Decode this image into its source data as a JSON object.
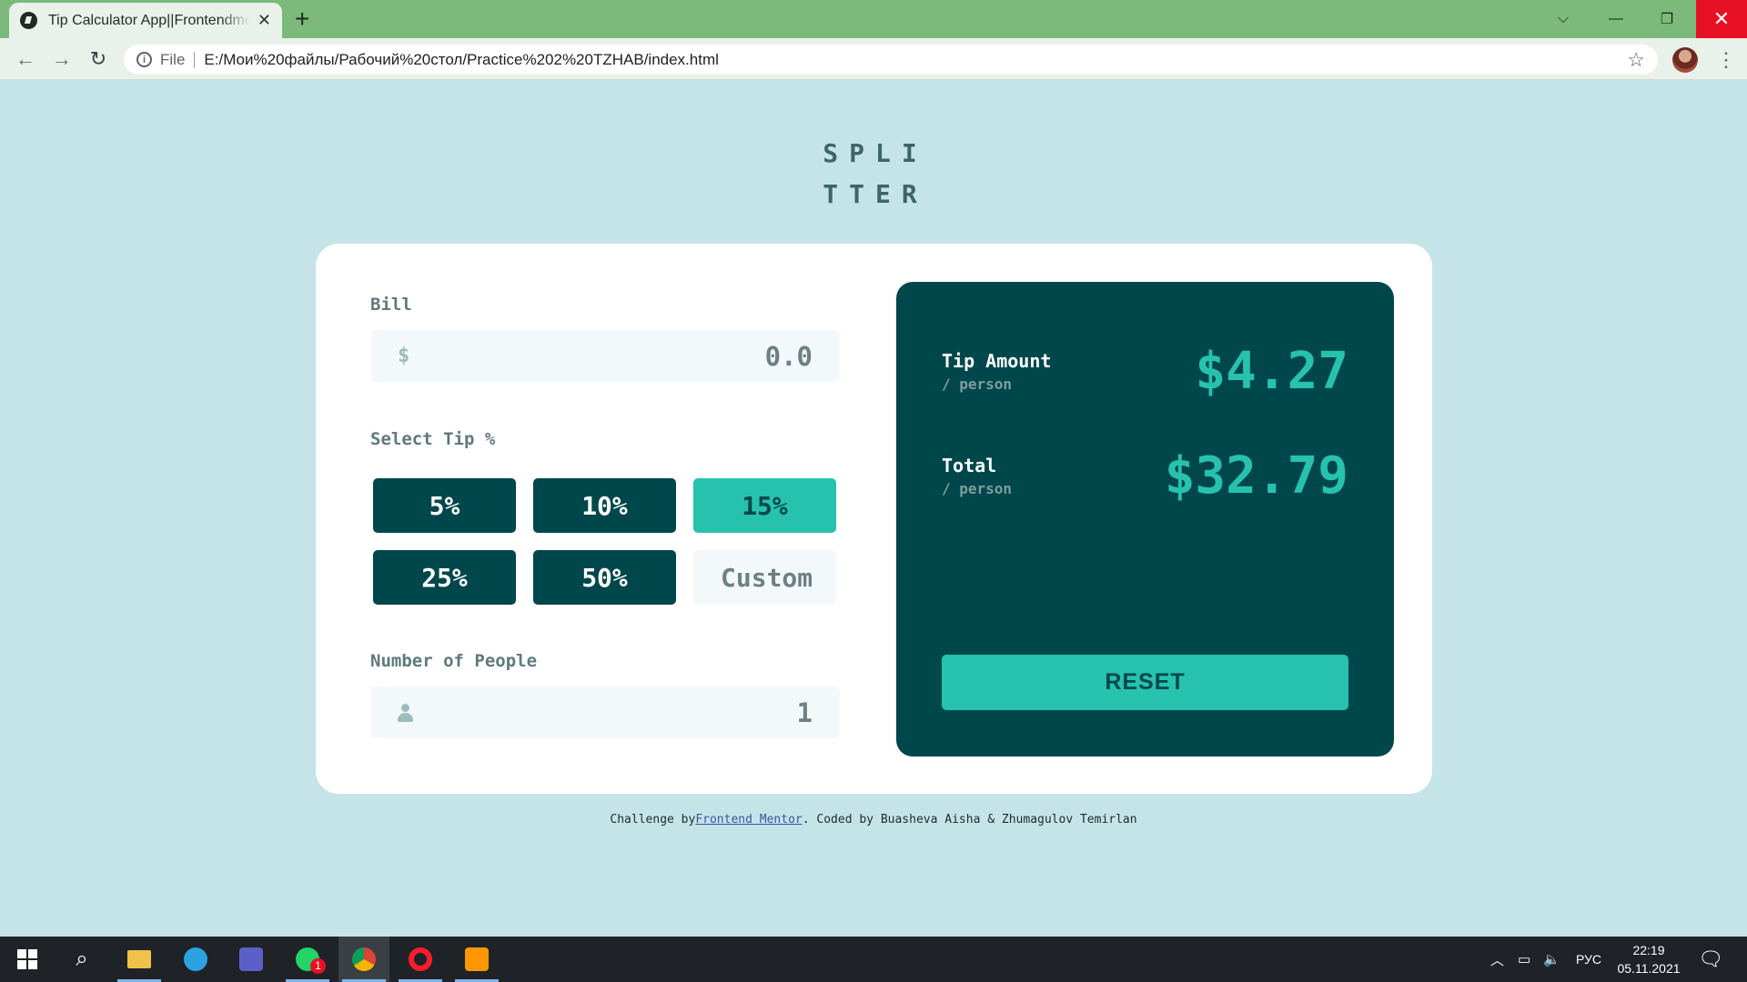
{
  "browser": {
    "tab_title": "Tip Calculator App||Frontendmentor",
    "address_scheme": "File",
    "url": "E:/Мои%20файлы/Рабочий%20стол/Practice%202%20TZHAB/index.html"
  },
  "logo": "SPLITTER",
  "form": {
    "bill_label": "Bill",
    "bill_currency": "$",
    "bill_value": "0.0",
    "tip_label": "Select Tip %",
    "tips": [
      "5%",
      "10%",
      "15%",
      "25%",
      "50%"
    ],
    "selected_tip": "15%",
    "custom_placeholder": "Custom",
    "people_label": "Number of People",
    "people_value": "1"
  },
  "results": {
    "tip_label": "Tip Amount",
    "tip_sub": "/ person",
    "tip_value": "$4.27",
    "total_label": "Total",
    "total_sub": "/ person",
    "total_value": "$32.79",
    "reset_label": "RESET"
  },
  "footer": {
    "prefix": "Challenge by",
    "link": "Frontend Mentor",
    "suffix": ". Coded by Buasheva Aisha & Zhumagulov Temirlan"
  },
  "taskbar": {
    "lang": "РУС",
    "time": "22:19",
    "date": "05.11.2021",
    "whatsapp_badge": "1"
  },
  "colors": {
    "page_bg": "#c5e4e7",
    "dark_cyan": "#00474b",
    "strong_cyan": "#26c2ae",
    "tabbar": "#7bba7a"
  }
}
